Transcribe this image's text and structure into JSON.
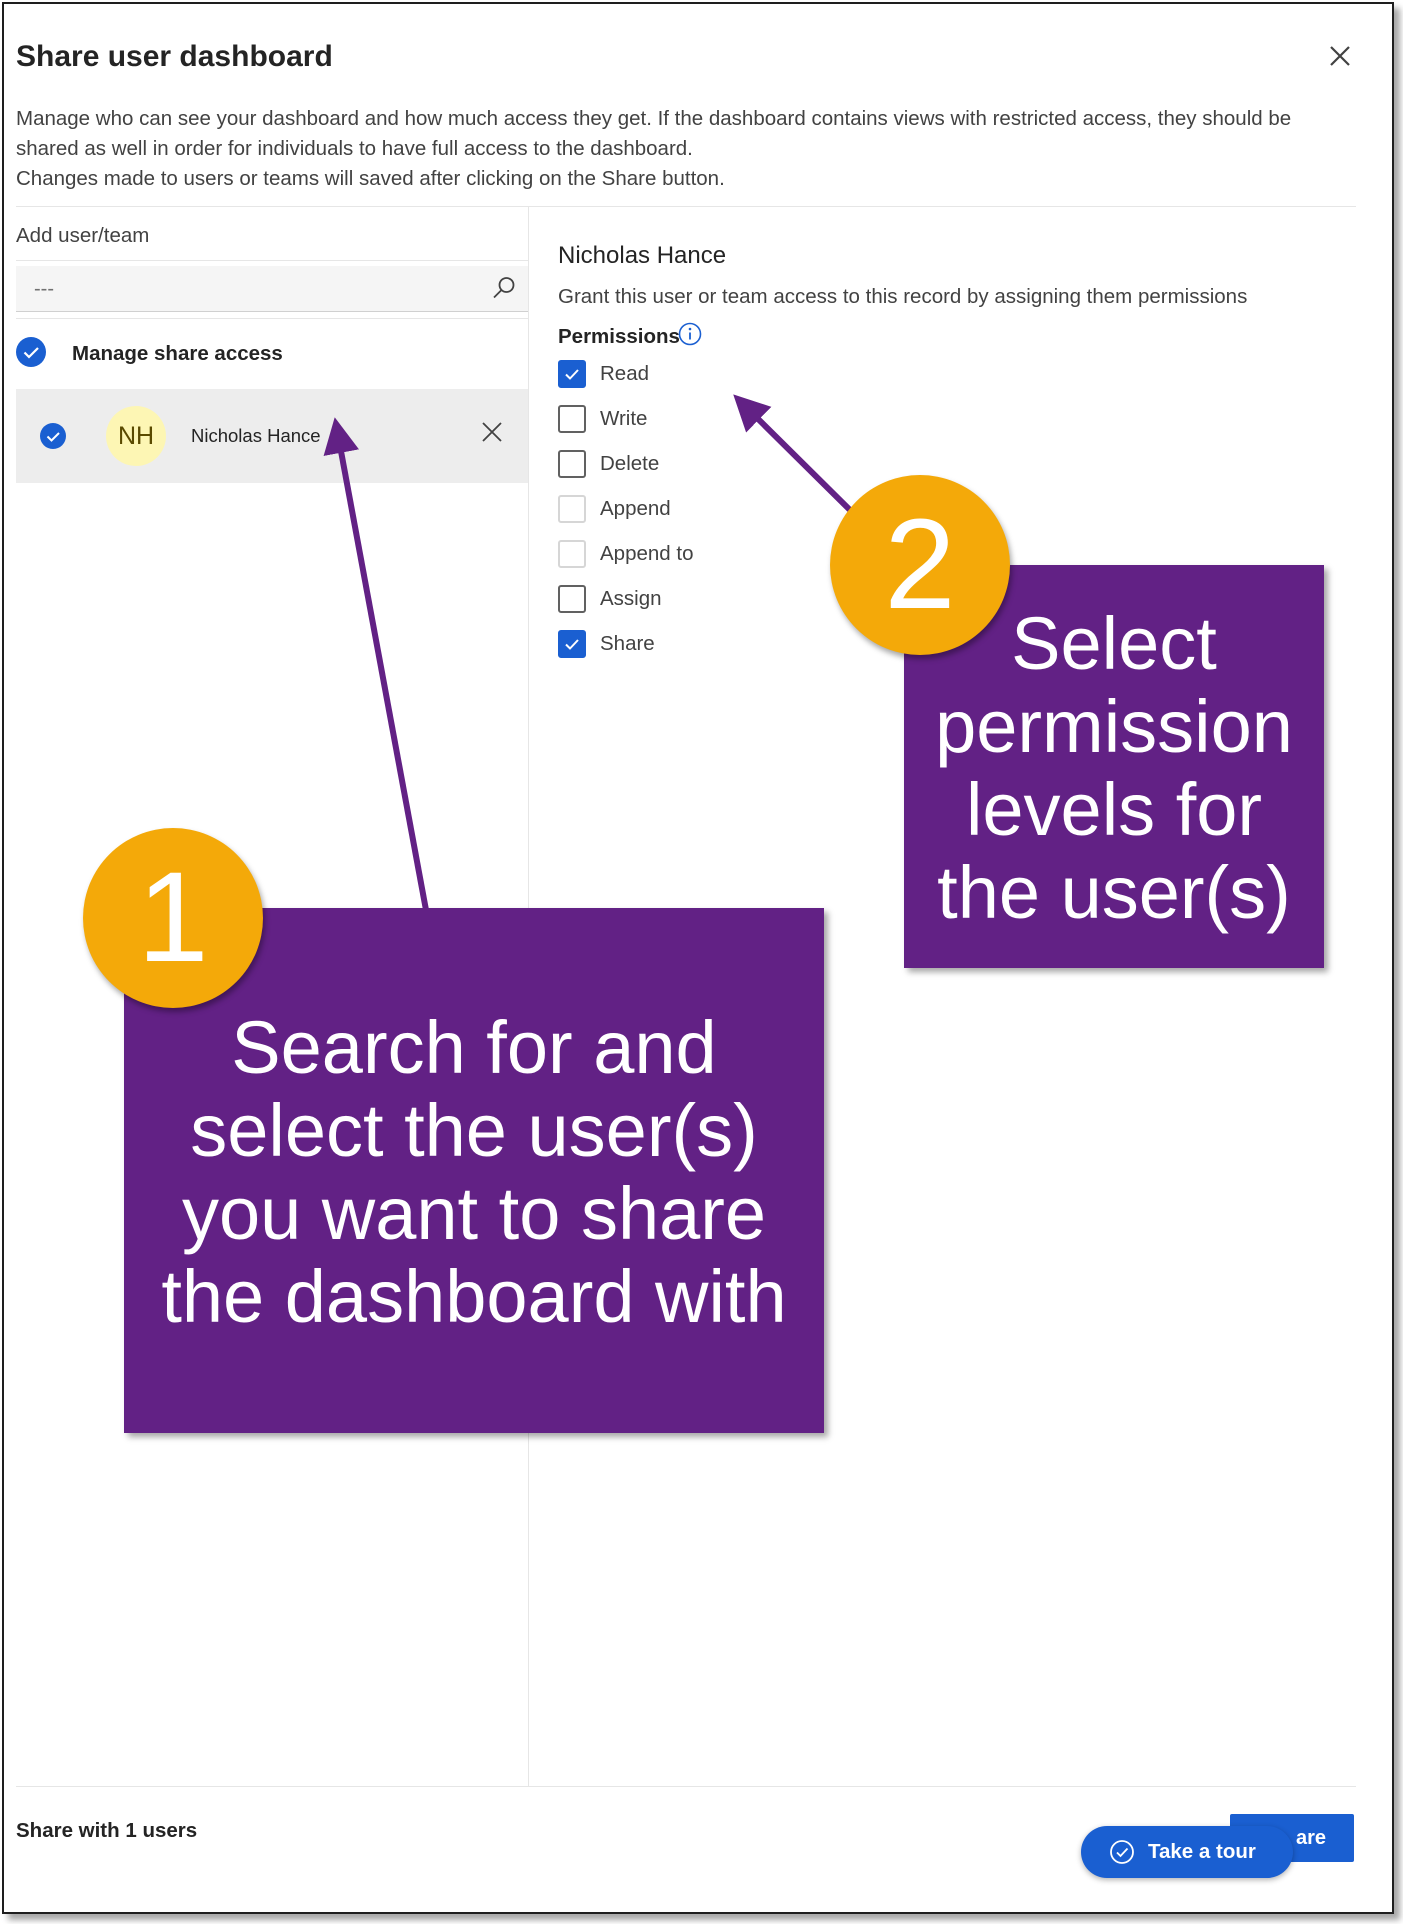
{
  "dialog": {
    "title": "Share user dashboard",
    "description_lines": [
      "Manage who can see your dashboard and how much access they get. If the dashboard contains views with restricted access, they should be",
      "shared as well in order for individuals to have full access to the dashboard.",
      "Changes made to users or teams will saved after clicking on the Share button."
    ]
  },
  "left_panel": {
    "add_label": "Add user/team",
    "search_placeholder": "---",
    "manage_label": "Manage share access",
    "user": {
      "initials": "NH",
      "name": "Nicholas Hance"
    }
  },
  "right_panel": {
    "user_name": "Nicholas Hance",
    "description": "Grant this user or team access to this record by assigning them permissions",
    "permissions_title": "Permissions",
    "permissions": [
      {
        "label": "Read",
        "checked": true,
        "disabled": false
      },
      {
        "label": "Write",
        "checked": false,
        "disabled": false
      },
      {
        "label": "Delete",
        "checked": false,
        "disabled": false
      },
      {
        "label": "Append",
        "checked": false,
        "disabled": true
      },
      {
        "label": "Append to",
        "checked": false,
        "disabled": true
      },
      {
        "label": "Assign",
        "checked": false,
        "disabled": false
      },
      {
        "label": "Share",
        "checked": true,
        "disabled": false
      }
    ]
  },
  "footer": {
    "share_count_label": "Share with 1 users",
    "share_button_label": "are",
    "tour_button_label": "Take a tour"
  },
  "annotations": {
    "badge_1": "1",
    "callout_1_lines": [
      "Search for and",
      "select the user(s)",
      "you want to share",
      "the dashboard with"
    ],
    "badge_2": "2",
    "callout_2_lines": [
      "Select",
      "permission",
      "levels for",
      "the user(s)"
    ]
  },
  "colors": {
    "accent": "#1a5fd1",
    "callout": "#622185",
    "badge": "#f4a909",
    "avatar_bg": "#fdf6b4"
  }
}
